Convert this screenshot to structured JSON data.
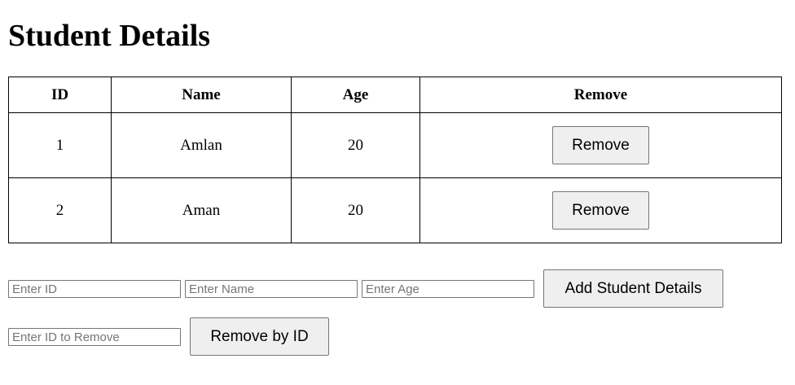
{
  "page": {
    "title": "Student Details"
  },
  "table": {
    "headers": {
      "id": "ID",
      "name": "Name",
      "age": "Age",
      "remove": "Remove"
    },
    "rows": [
      {
        "id": "1",
        "name": "Amlan",
        "age": "20",
        "remove_label": "Remove"
      },
      {
        "id": "2",
        "name": "Aman",
        "age": "20",
        "remove_label": "Remove"
      }
    ]
  },
  "add_form": {
    "id_placeholder": "Enter ID",
    "name_placeholder": "Enter Name",
    "age_placeholder": "Enter Age",
    "id_value": "",
    "name_value": "",
    "age_value": "",
    "submit_label": "Add Student Details"
  },
  "remove_form": {
    "id_placeholder": "Enter ID to Remove",
    "id_value": "",
    "submit_label": "Remove by ID"
  },
  "colors": {
    "border": "#000000",
    "button_bg": "#efefef",
    "button_border": "#767676",
    "placeholder": "#757575"
  }
}
